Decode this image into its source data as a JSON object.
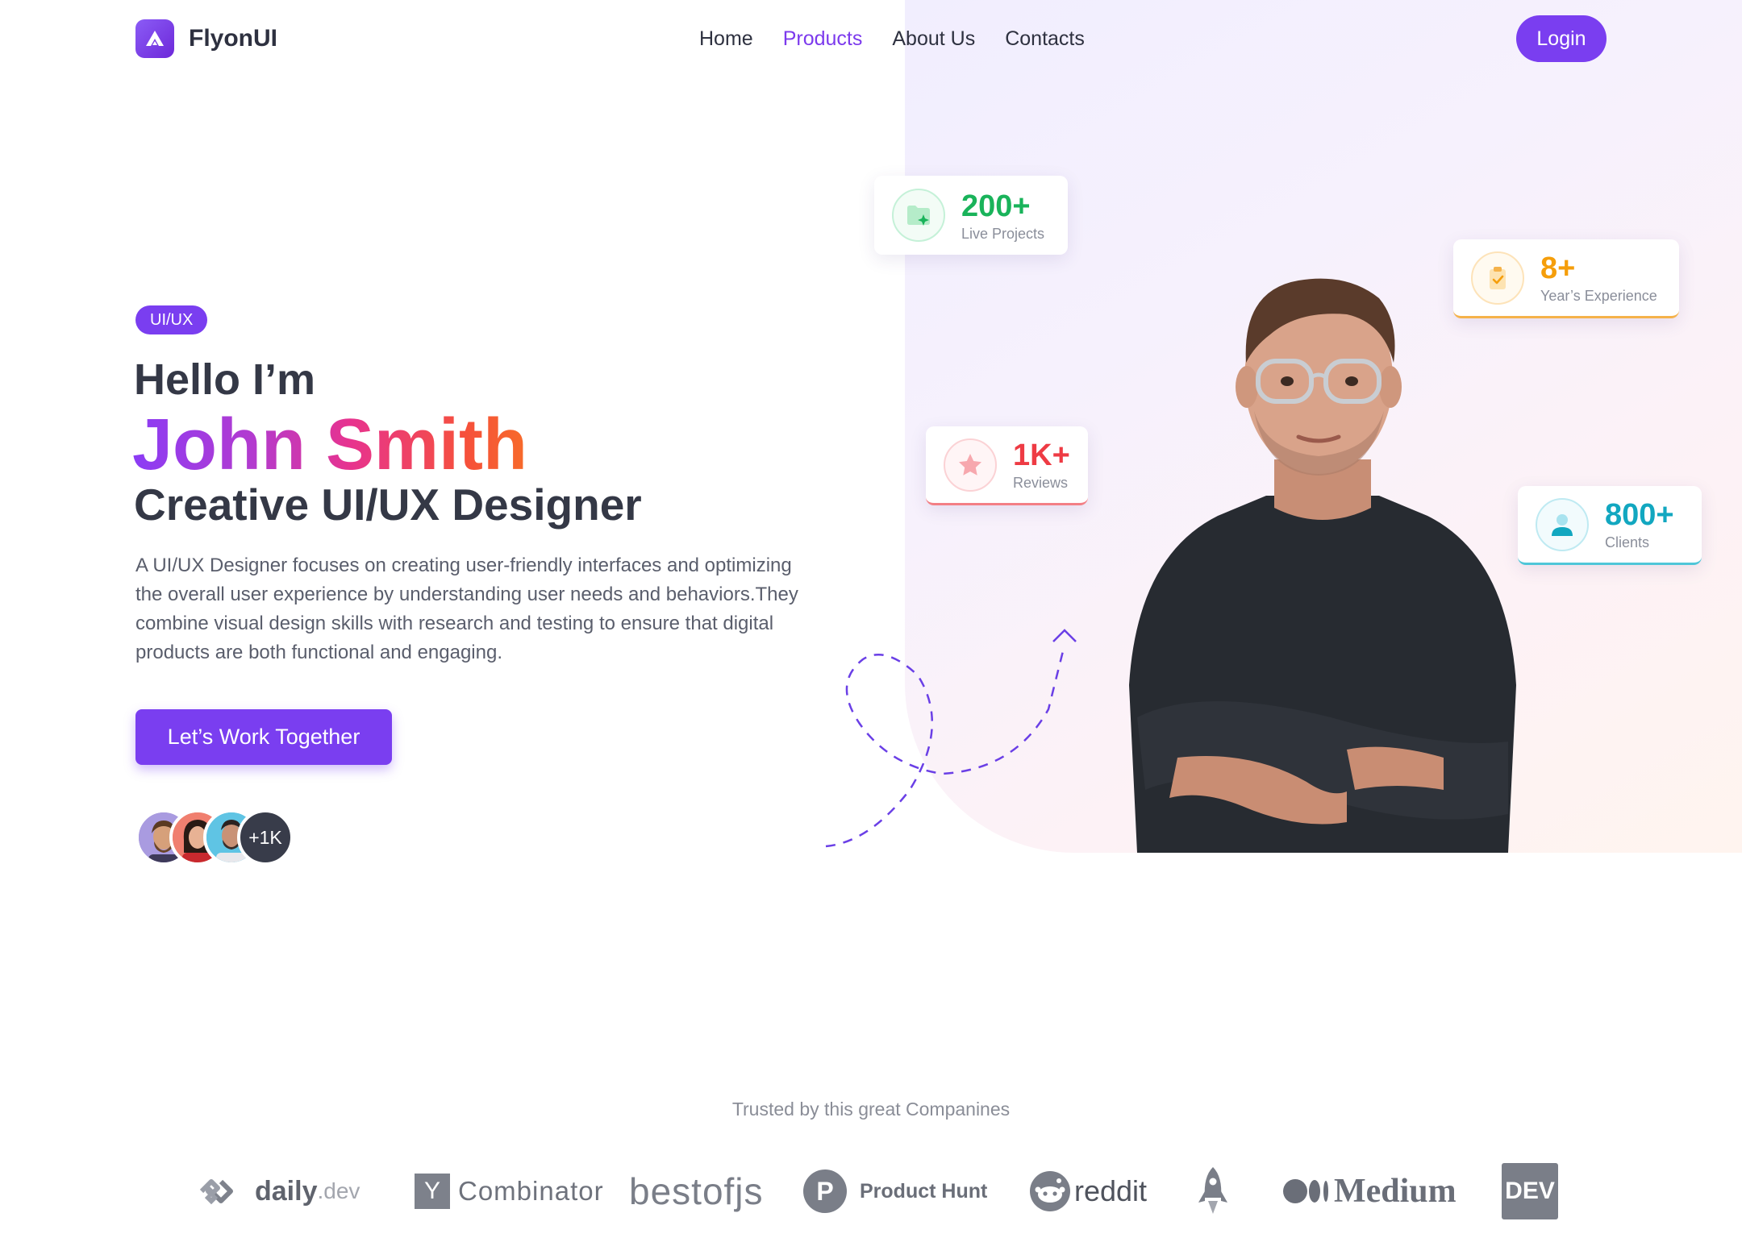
{
  "nav": {
    "brand": "FlyonUI",
    "items": [
      {
        "label": "Home"
      },
      {
        "label": "Products"
      },
      {
        "label": "About Us"
      },
      {
        "label": "Contacts"
      }
    ],
    "active": "Products",
    "login": "Login"
  },
  "hero": {
    "badge": "UI/UX",
    "hello": "Hello I’m",
    "name": "John Smith",
    "role": "Creative UI/UX Designer",
    "description": "A UI/UX Designer focuses on creating user-friendly interfaces and optimizing the overall user experience by understanding user needs and behaviors.They combine visual design skills with research and testing to ensure that digital products are both functional and engaging.",
    "cta": "Let’s Work Together",
    "avatar_more": "+1K"
  },
  "stats": [
    {
      "value": "200+",
      "label": "Live Projects",
      "icon": "folder-sparkle-icon",
      "color": "#19b35a"
    },
    {
      "value": "8+",
      "label": "Year’s Experience",
      "icon": "clipboard-check-icon",
      "color": "#f59e0b"
    },
    {
      "value": "1K+",
      "label": "Reviews",
      "icon": "star-icon",
      "color": "#ee3b44"
    },
    {
      "value": "800+",
      "label": "Clients",
      "icon": "user-icon",
      "color": "#12a7c0"
    }
  ],
  "trusted": {
    "title": "Trusted by this great Companines",
    "logos": [
      {
        "text": "daily",
        "suffix": ".dev"
      },
      {
        "mark": "Y",
        "text": "Combinator"
      },
      {
        "text": "bestofjs"
      },
      {
        "mark": "P",
        "text": "Product Hunt"
      },
      {
        "text": "reddit"
      },
      {
        "icon": "rocket-icon"
      },
      {
        "text": "Medium"
      },
      {
        "text": "DEV"
      }
    ]
  },
  "colors": {
    "primary": "#7a3ef0",
    "text": "#343846"
  }
}
